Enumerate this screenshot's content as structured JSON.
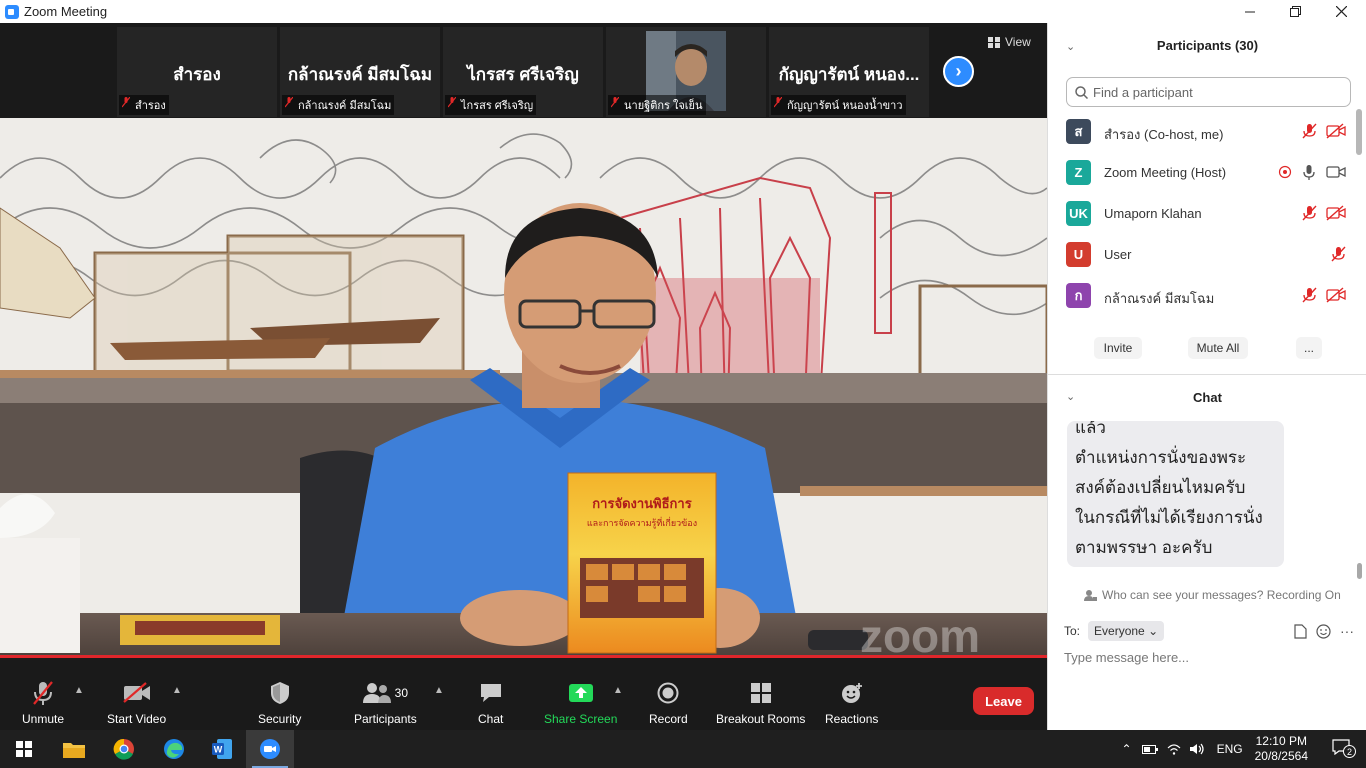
{
  "window": {
    "title": "Zoom Meeting",
    "controls": [
      "minimize",
      "maximize",
      "close"
    ]
  },
  "thumbnails": [
    {
      "display_name": "สำรอง",
      "label": "สำรอง",
      "has_video": false
    },
    {
      "display_name": "กล้าณรงค์ มีสมโฉม",
      "label": "กล้าณรงค์ มีสมโฉม",
      "has_video": false
    },
    {
      "display_name": "ไกรสร ศรีเจริญ",
      "label": "ไกรสร ศรีเจริญ",
      "has_video": false
    },
    {
      "display_name": "",
      "label": "นายฐิติกร ใจเย็น",
      "has_video": true
    },
    {
      "display_name": "กัญญารัตน์ หนอง...",
      "label": "กัญญารัตน์ หนองน้ำขาว",
      "has_video": false
    }
  ],
  "view_button": "View",
  "video_overlay": {
    "watermark": "zoom",
    "book_title": "การจัดงานพิธีการ",
    "book_subtitle": "และการจัดความรู้ที่เกี่ยวข้อง"
  },
  "toolbar": {
    "unmute": "Unmute",
    "start_video": "Start Video",
    "security": "Security",
    "participants": "Participants",
    "participants_count": "30",
    "chat": "Chat",
    "share_screen": "Share Screen",
    "record": "Record",
    "breakout_rooms": "Breakout Rooms",
    "reactions": "Reactions",
    "leave": "Leave"
  },
  "participants_panel": {
    "header": "Participants (30)",
    "search_placeholder": "Find a participant",
    "rows": [
      {
        "initial": "ส",
        "name": "สำรอง (Co-host, me)",
        "color": "#3d4a5c"
      },
      {
        "initial": "Z",
        "name": "Zoom Meeting (Host)",
        "color": "#1aa89a"
      },
      {
        "initial": "UK",
        "name": "Umaporn Klahan",
        "color": "#1aa89a"
      },
      {
        "initial": "U",
        "name": "User",
        "color": "#d33c2e"
      },
      {
        "initial": "ก",
        "name": "กล้าณรงค์ มีสมโฉม",
        "color": "#8e44ad"
      }
    ],
    "invite": "Invite",
    "mute_all": "Mute All",
    "more": "..."
  },
  "chat_panel": {
    "header": "Chat",
    "message_lines": [
      "แล้ว",
      "ตำแหน่งการนั่งของพระ",
      "สงค์ต้องเปลี่ยนไหมครับ",
      "ในกรณีที่ไม่ได้เรียงการนั่ง",
      "ตามพรรษา อะครับ"
    ],
    "privacy_note": "Who can see your messages? Recording On",
    "to_label": "To:",
    "recipient": "Everyone",
    "input_placeholder": "Type message here..."
  },
  "taskbar": {
    "language": "ENG",
    "time": "12:10 PM",
    "date": "20/8/2564",
    "notifications": "2"
  },
  "colors": {
    "accent": "#2d8cff",
    "leave": "#d92b2b",
    "share": "#23d959",
    "muted": "#e02828"
  }
}
